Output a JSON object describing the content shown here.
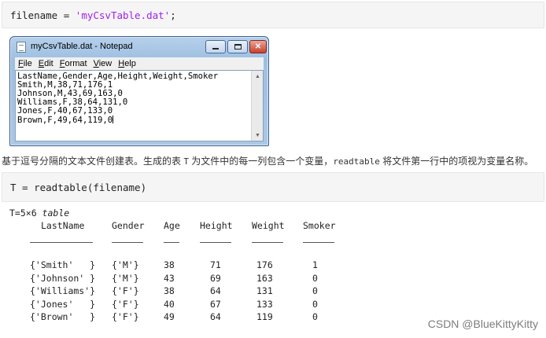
{
  "code1": {
    "var": "filename",
    "op": " = ",
    "str": "'myCsvTable.dat'",
    "end": ";"
  },
  "notepad": {
    "title": "myCsvTable.dat - Notepad",
    "menu": [
      "File",
      "Edit",
      "Format",
      "View",
      "Help"
    ],
    "lines": [
      "LastName,Gender,Age,Height,Weight,Smoker",
      "Smith,M,38,71,176,1",
      "Johnson,M,43,69,163,0",
      "Williams,F,38,64,131,0",
      "Jones,F,40,67,133,0",
      "Brown,F,49,64,119,0"
    ]
  },
  "description": {
    "part1": "基于逗号分隔的文本文件创建表。生成的表 ",
    "t": "T",
    "part2": " 为文件中的每一列包含一个变量，",
    "fn": "readtable",
    "part3": " 将文件第一行中的项视为变量名称。"
  },
  "code2": "T = readtable(filename)",
  "output": {
    "dims_prefix": "T=5×6 ",
    "dims_word": "table",
    "headers": [
      "LastName",
      "Gender",
      "Age",
      "Height",
      "Weight",
      "Smoker"
    ],
    "rows": [
      [
        "{'Smith'   }",
        "{'M'}",
        "38",
        "71",
        "176",
        "1"
      ],
      [
        "{'Johnson' }",
        "{'M'}",
        "43",
        "69",
        "163",
        "0"
      ],
      [
        "{'Williams'}",
        "{'F'}",
        "38",
        "64",
        "131",
        "0"
      ],
      [
        "{'Jones'   }",
        "{'F'}",
        "40",
        "67",
        "133",
        "0"
      ],
      [
        "{'Brown'   }",
        "{'F'}",
        "49",
        "64",
        "119",
        "0"
      ]
    ]
  },
  "watermark": "CSDN @BlueKittyKitty"
}
